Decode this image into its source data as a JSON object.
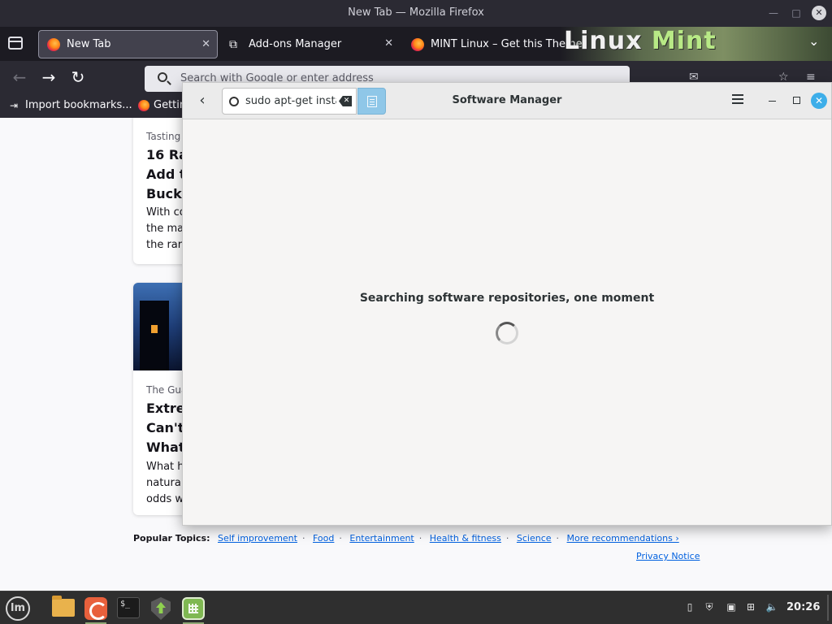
{
  "firefox": {
    "window_title": "New Tab — Mozilla Firefox",
    "tabs": [
      {
        "label": "New Tab",
        "active": true,
        "icon": "firefox-icon"
      },
      {
        "label": "Add-ons Manager",
        "active": false,
        "icon": "puzzle-icon"
      },
      {
        "label": "MINT Linux – Get this Theme",
        "active": false,
        "icon": "firefox-icon"
      }
    ],
    "theme_brand": {
      "part1": "Linux ",
      "part2": "Mint"
    },
    "urlbar_placeholder": "Search with Google or enter address",
    "bookmarks": [
      {
        "label": "Import bookmarks...",
        "icon": "import-icon"
      },
      {
        "label": "Gettin",
        "icon": "firefox-icon"
      }
    ]
  },
  "newtab": {
    "card1": {
      "source": "Tasting",
      "headline_lines": [
        "16 Ra",
        "Add t",
        "Bucke"
      ],
      "excerpt_lines": [
        "With co",
        "the ma",
        "the rar"
      ]
    },
    "card2": {
      "source": "The Gua",
      "headline_lines": [
        "Extre",
        "Can't",
        "What"
      ],
      "excerpt_lines": [
        "What h",
        "natural",
        "odds w"
      ]
    },
    "popular_label": "Popular Topics:",
    "topics": [
      "Self improvement",
      "Food",
      "Entertainment",
      "Health & fitness",
      "Science",
      "More recommendations ›"
    ],
    "separator": "·",
    "privacy_notice": "Privacy Notice"
  },
  "software_manager": {
    "title": "Software Manager",
    "search_value": "sudo apt-get insta",
    "loading_text": "Searching software repositories, one moment",
    "accent": "#3daee9"
  },
  "taskbar": {
    "clock": "20:26",
    "menu_glyph": "lm",
    "terminal_prompt": "$_",
    "apps": [
      "files-icon",
      "firefox-icon",
      "terminal-icon",
      "update-manager-icon",
      "software-manager-icon"
    ]
  }
}
